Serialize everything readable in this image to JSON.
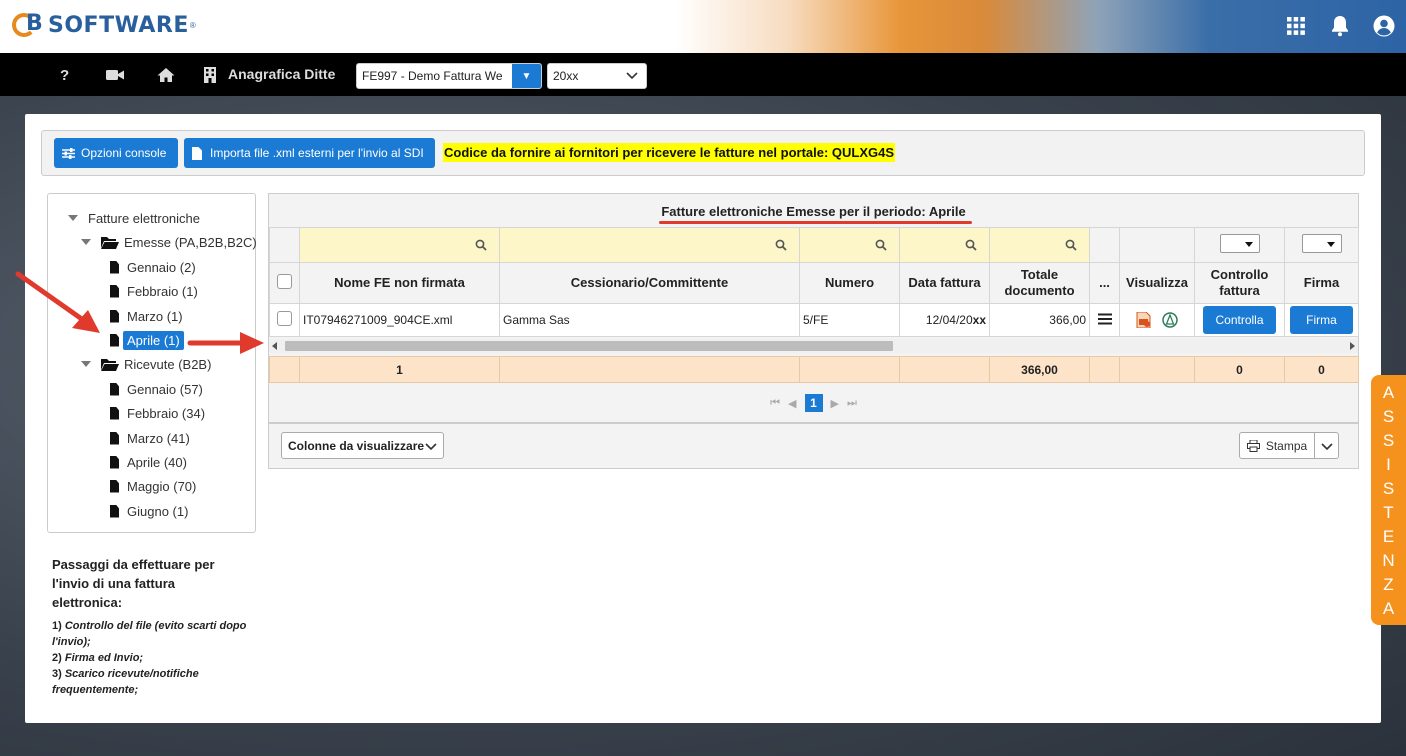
{
  "brand": {
    "logo_text": "SOFTWARE",
    "logo_mark": "B"
  },
  "nav": {
    "help": "?",
    "anagrafica_label": "Anagrafica Ditte",
    "ditta_value": "FE997 - Demo Fattura We",
    "year_value": "20xx"
  },
  "toolbar": {
    "opzioni_label": "Opzioni console",
    "importa_label": "Importa file .xml esterni per l'invio al SDI",
    "codice_text": "Codice da fornire ai fornitori per ricevere le fatture nel portale: QULXG4S"
  },
  "tree": {
    "root": "Fatture elettroniche",
    "emesse": "Emesse (PA,B2B,B2C)",
    "emesse_items": [
      "Gennaio (2)",
      "Febbraio (1)",
      "Marzo (1)",
      "Aprile (1)"
    ],
    "ricevute": "Ricevute (B2B)",
    "ricevute_items": [
      "Gennaio (57)",
      "Febbraio (34)",
      "Marzo (41)",
      "Aprile (40)",
      "Maggio (70)",
      "Giugno (1)"
    ]
  },
  "steps": {
    "title": "Passaggi da effettuare per l'invio di una fattura elettronica:",
    "items": [
      {
        "num": "1)",
        "text": "Controllo del file (evito scarti dopo l'invio);"
      },
      {
        "num": "2)",
        "text": "Firma ed Invio;"
      },
      {
        "num": "3)",
        "text": "Scarico ricevute/notifiche frequentemente;"
      }
    ]
  },
  "grid": {
    "title": "Fatture elettroniche Emesse per il periodo: Aprile",
    "columns": [
      "Nome FE non firmata",
      "Cessionario/Committente",
      "Numero",
      "Data fattura",
      "Totale documento",
      "...",
      "Visualizza",
      "Controllo fattura",
      "Firma"
    ],
    "row": {
      "nome": "IT07946271009_904CE.xml",
      "cessionario": "Gamma Sas",
      "numero": "5/FE",
      "data": "12/04/20",
      "data_suffix": "xx",
      "totale": "366,00",
      "controlla_label": "Controlla",
      "firma_label": "Firma"
    },
    "totals": {
      "count": "1",
      "totale": "366,00",
      "controllo": "0",
      "firma": "0"
    },
    "page": "1"
  },
  "footer": {
    "colonne_label": "Colonne da visualizzare",
    "stampa_label": "Stampa"
  },
  "assistenza": [
    "A",
    "S",
    "S",
    "I",
    "S",
    "T",
    "E",
    "N",
    "Z",
    "A"
  ],
  "colors": {
    "accent": "#1b7bd4",
    "assist": "#f5921e",
    "highlight": "#ffff00",
    "annotation": "#e03a2c"
  }
}
